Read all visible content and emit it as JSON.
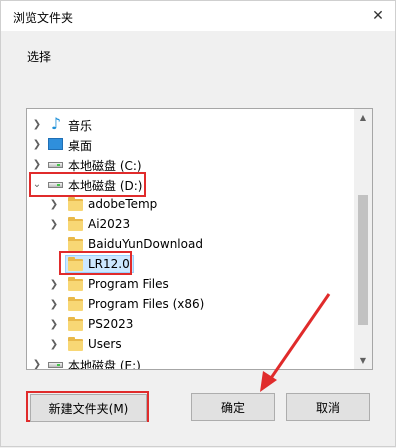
{
  "window": {
    "title": "浏览文件夹",
    "close_glyph": "✕"
  },
  "description": "选择",
  "tree": {
    "items": [
      {
        "label": "音乐",
        "icon": "music-icon",
        "expanded": false
      },
      {
        "label": "桌面",
        "icon": "desktop-icon",
        "expanded": false
      },
      {
        "label": "本地磁盘 (C:)",
        "icon": "drive-icon",
        "expanded": false
      },
      {
        "label": "本地磁盘 (D:)",
        "icon": "drive-icon",
        "expanded": true
      },
      {
        "label": "adobeTemp",
        "icon": "folder-icon"
      },
      {
        "label": "Ai2023",
        "icon": "folder-icon"
      },
      {
        "label": "BaiduYunDownload",
        "icon": "folder-icon"
      },
      {
        "label": "LR12.0",
        "icon": "folder-icon",
        "selected": true
      },
      {
        "label": "Program Files",
        "icon": "folder-icon"
      },
      {
        "label": "Program Files (x86)",
        "icon": "folder-icon"
      },
      {
        "label": "PS2023",
        "icon": "folder-icon"
      },
      {
        "label": "Users",
        "icon": "folder-icon"
      },
      {
        "label": "本地磁盘 (E:)",
        "icon": "drive-icon",
        "expanded": false
      }
    ]
  },
  "buttons": {
    "new_folder": "新建文件夹(M)",
    "ok": "确定",
    "cancel": "取消"
  },
  "colors": {
    "highlight": "#e02b2b",
    "selection": "#cce8ff"
  }
}
